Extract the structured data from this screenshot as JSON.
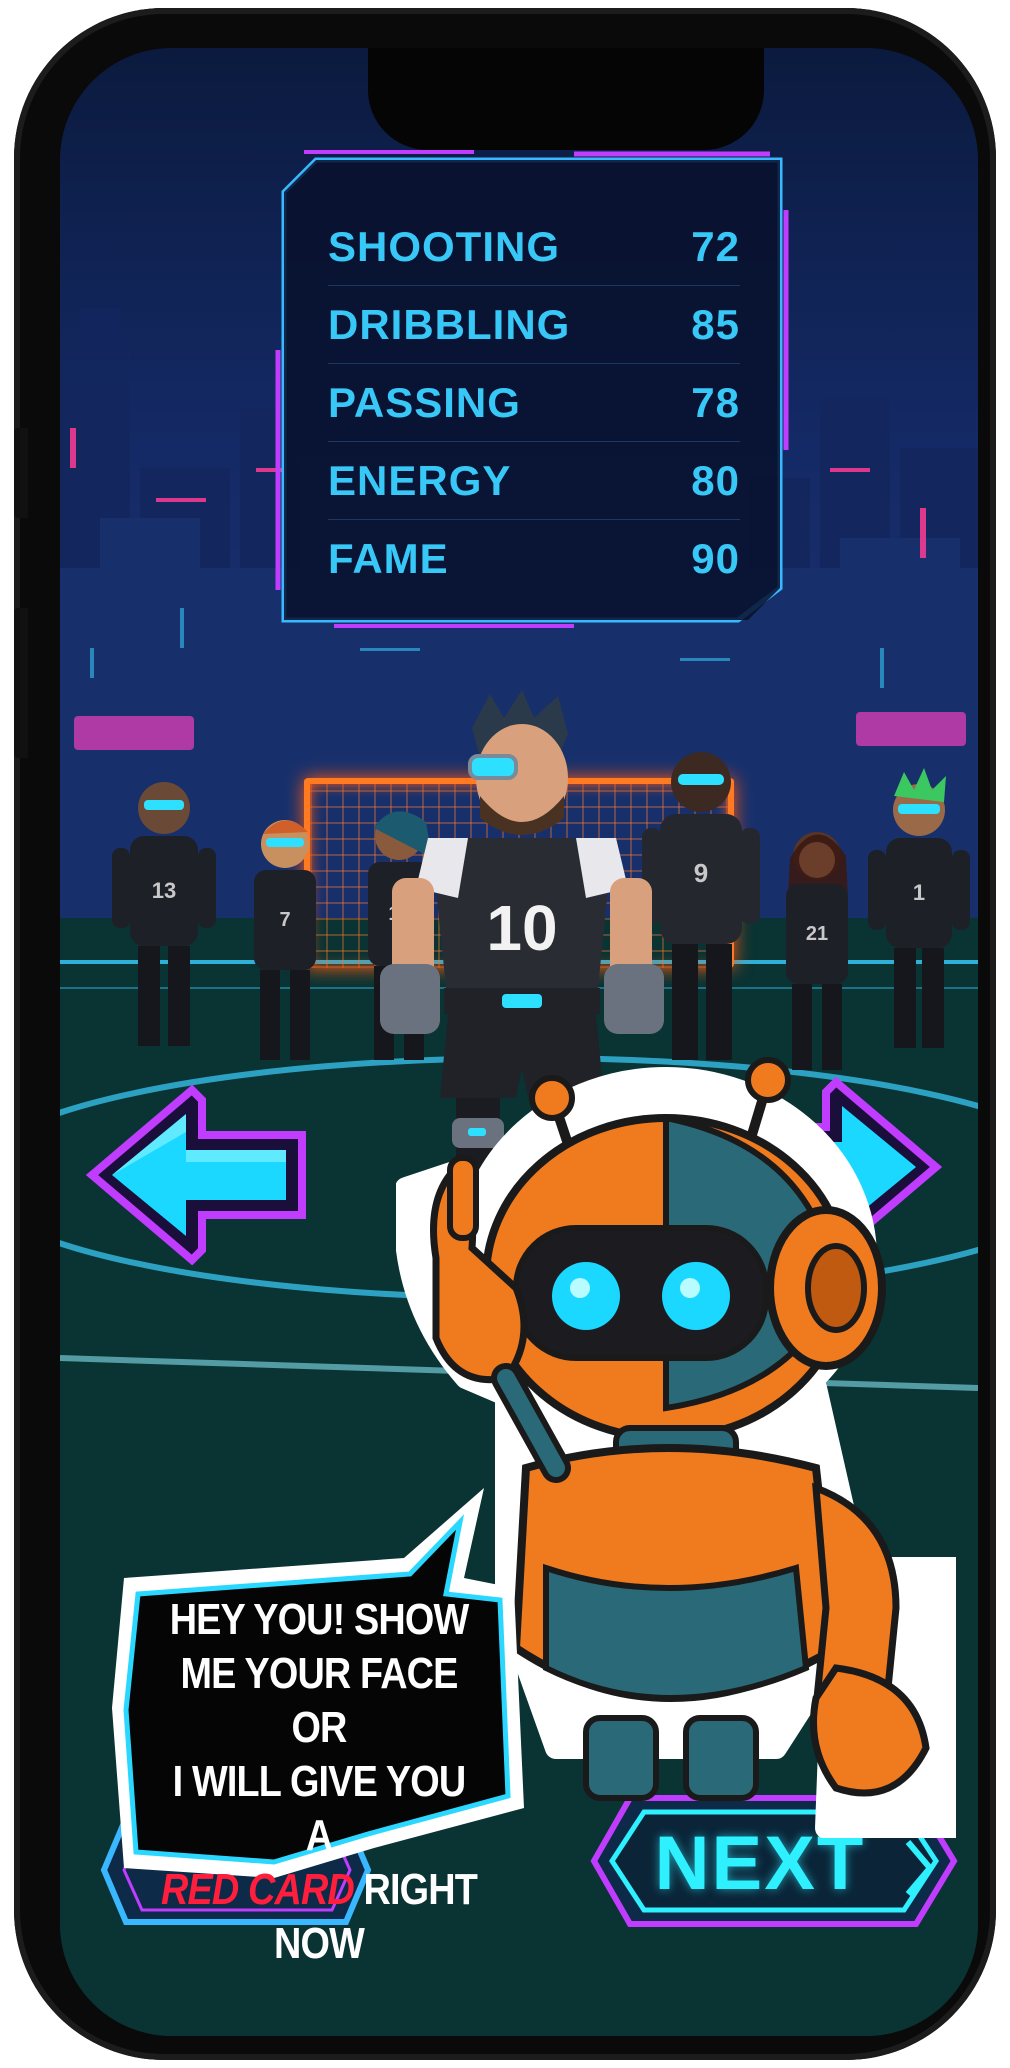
{
  "stats": [
    {
      "label": "SHOOTING",
      "value": "72"
    },
    {
      "label": "DRIBBLING",
      "value": "85"
    },
    {
      "label": "PASSING",
      "value": "78"
    },
    {
      "label": "ENERGY",
      "value": "80"
    },
    {
      "label": "FAME",
      "value": "90"
    }
  ],
  "featured_player": {
    "number": "10"
  },
  "team_numbers": [
    "13",
    "7",
    "11",
    "9",
    "21",
    "1"
  ],
  "speech": {
    "line1": "HEY YOU! SHOW",
    "line2": "ME YOUR FACE OR",
    "line3": "I WILL GIVE YOU A",
    "highlight": "RED CARD",
    "line4_rest": " RIGHT",
    "line5": "NOW"
  },
  "buttons": {
    "next_label": "NEXT"
  },
  "icons": {
    "prev": "arrow-left-icon",
    "next": "arrow-right-icon",
    "next_chevron": "chevron-right-icon"
  },
  "colors": {
    "stat_text": "#38c8f8",
    "neon_cyan": "#2ef0ff",
    "neon_magenta": "#c03cff",
    "red_card": "#ff1e3c",
    "robot_orange": "#f07a1e",
    "goal_orange": "#ff7a20"
  }
}
